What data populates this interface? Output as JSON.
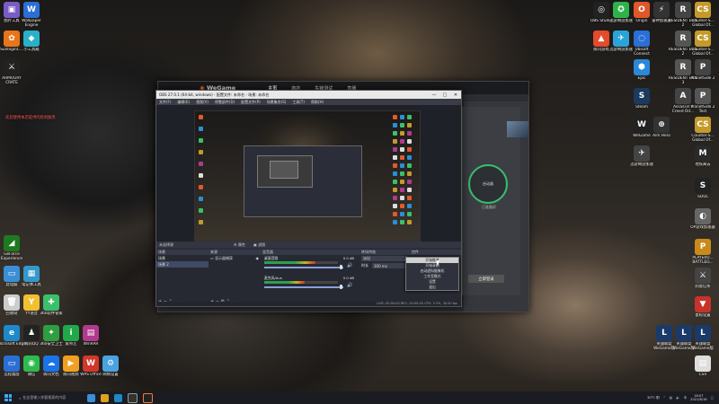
{
  "desktop": {
    "left_icons": [
      {
        "label": "图片工具",
        "color": "#7a5cc7",
        "glyph": "▣"
      },
      {
        "label": "Wallpaper Engine",
        "color": "#2b6fd6",
        "glyph": "W"
      },
      {
        "label": "SunloginC...",
        "color": "#e8751a",
        "glyph": "✿"
      },
      {
        "label": "小工具箱",
        "color": "#2ab0c9",
        "glyph": "◆"
      },
      {
        "label": "ARMOURY CRATE",
        "color": "#222222",
        "glyph": "⚔"
      },
      {
        "label": "GeForce Experience",
        "color": "#1f7a1f",
        "glyph": "◢"
      },
      {
        "label": "此电脑",
        "color": "#3a8fd6",
        "glyph": "▭"
      },
      {
        "label": "笔记本工具",
        "color": "#3399cc",
        "glyph": "▦"
      },
      {
        "label": "回收站",
        "color": "#cccccc",
        "glyph": "🗑"
      },
      {
        "label": "YY语音",
        "color": "#f0c030",
        "glyph": "Y"
      },
      {
        "label": "360软件管家",
        "color": "#3ac06a",
        "glyph": "✚"
      },
      {
        "label": "Microsoft Edge",
        "color": "#1e88c9",
        "glyph": "e"
      },
      {
        "label": "腾讯QQ",
        "color": "#222222",
        "glyph": "♟"
      },
      {
        "label": "360安全卫士",
        "color": "#2e9e41",
        "glyph": "✦"
      },
      {
        "label": "爱奇艺",
        "color": "#21a84a",
        "glyph": "i"
      },
      {
        "label": "WinRAR",
        "color": "#b03a8e",
        "glyph": "▤"
      },
      {
        "label": "远程桌面",
        "color": "#2b6fd6",
        "glyph": "▭"
      },
      {
        "label": "微信",
        "color": "#2dbb4f",
        "glyph": "◉"
      },
      {
        "label": "腾讯文档",
        "color": "#1a73e8",
        "glyph": "☁"
      },
      {
        "label": "腾讯视频",
        "color": "#f0a020",
        "glyph": "▶"
      },
      {
        "label": "WPS Office",
        "color": "#d0382b",
        "glyph": "W"
      },
      {
        "label": "网络设置",
        "color": "#4aa3e0",
        "glyph": "⚙"
      }
    ],
    "right_icons": [
      {
        "label": "OBS Studio",
        "color": "#222222",
        "glyph": "◎"
      },
      {
        "label": "迅游网游加速",
        "color": "#2eb34a",
        "glyph": "✪"
      },
      {
        "label": "Origin",
        "color": "#e0572a",
        "glyph": "O"
      },
      {
        "label": "雷神加速器",
        "color": "#333333",
        "glyph": "⚡"
      },
      {
        "label": "RESIDENT EVIL 2",
        "color": "#444444",
        "glyph": "R"
      },
      {
        "label": "Counter-S... Global Of...",
        "color": "#c49a2a",
        "glyph": "CS"
      },
      {
        "label": "腾讯游戏",
        "color": "#e34b2a",
        "glyph": "▲"
      },
      {
        "label": "迅游网游加速",
        "color": "#2aa3d9",
        "glyph": "✈"
      },
      {
        "label": "Ubisoft Connect",
        "color": "#2a6fd6",
        "glyph": "◌"
      },
      {
        "label": "RESIDENT EVIL 2",
        "color": "#555555",
        "glyph": "R"
      },
      {
        "label": "Counter-S... Global Of...",
        "color": "#c49a2a",
        "glyph": "CS"
      },
      {
        "label": "Epic",
        "color": "#2a88d9",
        "glyph": "⬢"
      },
      {
        "label": "RESIDENT EVIL 3",
        "color": "#555555",
        "glyph": "R"
      },
      {
        "label": "PlanetSide 2",
        "color": "#444444",
        "glyph": "P"
      },
      {
        "label": "Steam",
        "color": "#1b3a5c",
        "glyph": "S"
      },
      {
        "label": "Assassin's Creed Od...",
        "color": "#444444",
        "glyph": "A"
      },
      {
        "label": "PlanetSide 2 Test",
        "color": "#555555",
        "glyph": "P"
      },
      {
        "label": "WeGame",
        "color": "#222222",
        "glyph": "W"
      },
      {
        "label": "Aim Hero",
        "color": "#333333",
        "glyph": "⊕"
      },
      {
        "label": "Counter-S... Global Of...",
        "color": "#c49a2a",
        "glyph": "CS"
      },
      {
        "label": "迅游网游加速",
        "color": "#444444",
        "glyph": "✈"
      },
      {
        "label": "地铁离去",
        "color": "#2a2a2a",
        "glyph": "M"
      },
      {
        "label": "SOUL",
        "color": "#222222",
        "glyph": "S"
      },
      {
        "label": "OP游戏加速器",
        "color": "#666666",
        "glyph": "◐"
      },
      {
        "label": "PLAYERU... BATTLEG...",
        "color": "#c98a1a",
        "glyph": "P"
      },
      {
        "label": "刺客信条",
        "color": "#444444",
        "glyph": "⚔"
      },
      {
        "label": "鼠标设置",
        "color": "#c7332a",
        "glyph": "▼"
      },
      {
        "label": "英雄联盟 WeGame版",
        "color": "#1a3a6a",
        "glyph": "L"
      },
      {
        "label": "英雄联盟 WeGame版",
        "color": "#1a3a6a",
        "glyph": "L"
      },
      {
        "label": "英雄联盟 WeGame版",
        "color": "#1a3a6a",
        "glyph": "L"
      },
      {
        "label": "CSV",
        "color": "#dddddd",
        "glyph": "▤"
      }
    ],
    "wallpaper_banner": "欢迎使用本店提供的装机服务"
  },
  "wegame": {
    "logo": "WeGame",
    "nav": [
      "主页",
      "商店",
      "先锋测试",
      "直播"
    ],
    "circle_text": "启动器",
    "desc": "已准备好",
    "button": "立即登录"
  },
  "obs": {
    "title": "OBS 27.0.1 (64-bit, windows) - 配置文件: 未命名 - 场景: 未命名",
    "menu": [
      "文件(F)",
      "编辑(E)",
      "视图(V)",
      "停靠部件(D)",
      "配置文件(P)",
      "场景集合(S)",
      "工具(T)",
      "帮助(H)"
    ],
    "preview_label": "未选择源",
    "preview_toolbar": [
      "属性",
      "滤镜"
    ],
    "docks": {
      "scenes": {
        "title": "场景",
        "items": [
          "场景",
          "场景 2"
        ]
      },
      "sources": {
        "title": "来源",
        "items": [
          "显示器捕获"
        ]
      },
      "mixer": {
        "title": "混音器",
        "tracks": [
          {
            "name": "桌面音频",
            "db": "0.0 dB",
            "level": 0.7
          },
          {
            "name": "麦克风/Aux",
            "db": "0.0 dB",
            "level": 0.55
          }
        ]
      },
      "transitions": {
        "title": "转场特效",
        "type": "淡出",
        "duration_label": "时长",
        "duration": "300 ms"
      },
      "controls": {
        "title": "控件",
        "buttons": [
          "开始推流",
          "开始录制",
          "启动虚拟摄像机",
          "工作室模式",
          "设置",
          "退出"
        ]
      }
    },
    "status": "LIVE: 00:00:00  REC: 00:00:00  CPU: 3.3%, 30.00 fps"
  },
  "context_menu": {
    "items": [
      "开始推流",
      "开始录制",
      "启动虚拟摄像机",
      "工作室模式",
      "设置",
      "退出"
    ],
    "highlighted": 0
  },
  "taskbar": {
    "search_placeholder": "在这里输入你要搜索的内容",
    "time": "18:07",
    "date": "2021/6/16",
    "lang": "中",
    "tray_label": "30°C 阴"
  }
}
